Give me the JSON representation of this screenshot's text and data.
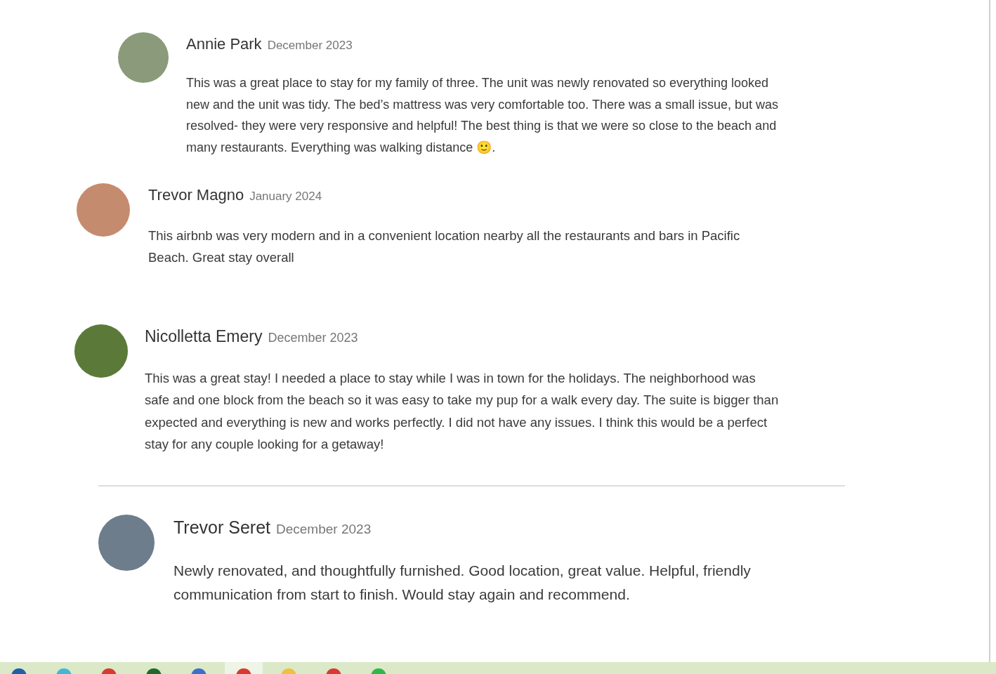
{
  "reviews": [
    {
      "name": "Annie Park",
      "date": "December 2023",
      "text": "This was a great place to stay for my family of three. The unit was newly renovated so everything looked new and the unit was tidy. The bed’s mattress was very comfortable too. There was a small issue, but was resolved- they were very responsive and helpful! The best thing is that we were so close to the beach and many restaurants. Everything was walking distance 🙂.",
      "divider_above": false
    },
    {
      "name": "Trevor Magno",
      "date": "January 2024",
      "text": "This airbnb was very modern and in a convenient location nearby all the restaurants and bars in Pacific Beach. Great stay overall",
      "divider_above": false
    },
    {
      "name": "Nicolletta Emery",
      "date": "December 2023",
      "text": "This was a great stay! I needed a place to stay while I was in town for the holidays. The neighborhood was safe and one block from the beach so it was easy to take my pup for a walk every day. The suite is bigger than expected and everything is new and works perfectly. I did not have any issues. I think this would be a perfect stay for any couple looking for a getaway!",
      "divider_above": false
    },
    {
      "name": "Trevor Seret",
      "date": "December 2023",
      "text": "Newly renovated, and thoughtfully furnished. Good location, great value. Helpful, friendly communication from start to finish. Would stay again and recommend.",
      "divider_above": true
    }
  ],
  "taskbar": [
    {
      "color": "#1f5fa8"
    },
    {
      "color": "#3fb8d8"
    },
    {
      "color": "#d93a2f"
    },
    {
      "color": "#1d6b2c"
    },
    {
      "color": "#3b6fc9"
    },
    {
      "color": "#d93a2f",
      "selected": true
    },
    {
      "color": "#f0c040"
    },
    {
      "color": "#d93a2f"
    },
    {
      "color": "#2fb84a"
    }
  ]
}
